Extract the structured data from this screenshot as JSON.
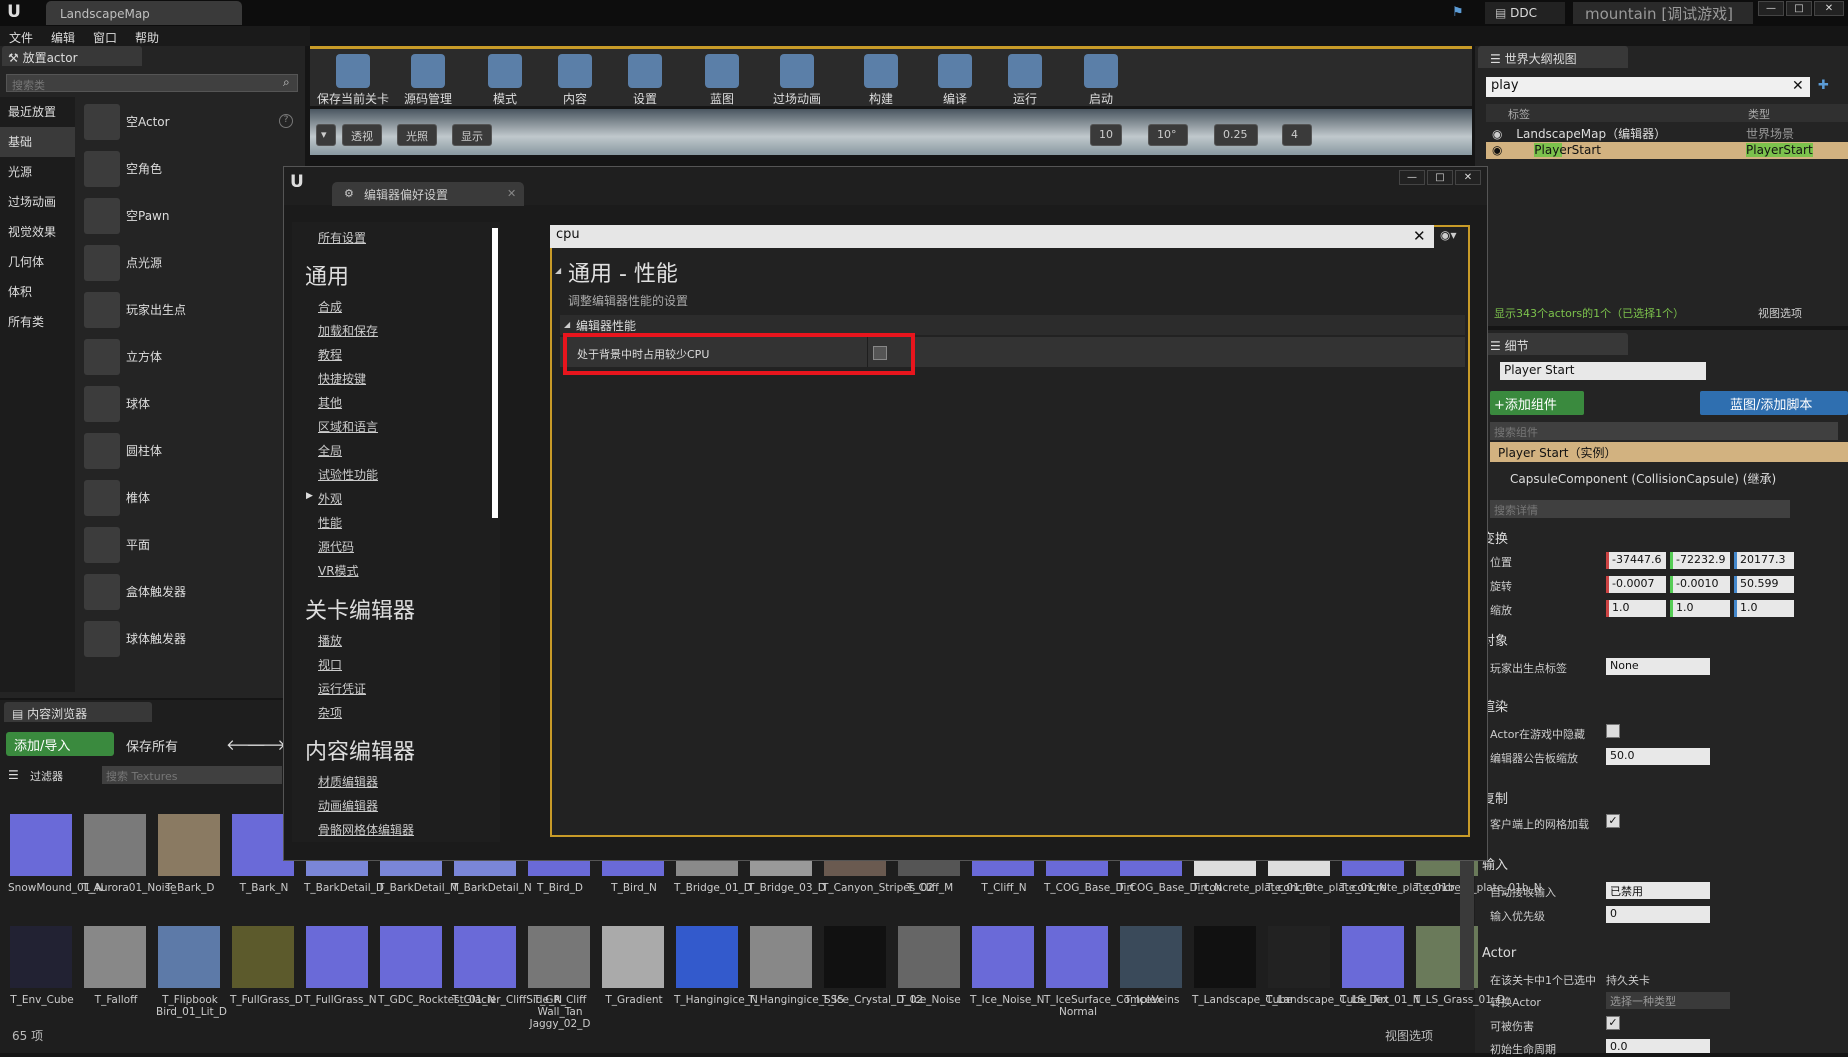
{
  "window": {
    "doc_tab": "LandscapeMap",
    "ddc": "DDC",
    "project": "mountain [调试游戏]"
  },
  "menu": [
    "文件",
    "编辑",
    "窗口",
    "帮助"
  ],
  "place_actors": {
    "tab": "放置actor",
    "search_placeholder": "搜索类",
    "categories": [
      "最近放置",
      "基础",
      "光源",
      "过场动画",
      "视觉效果",
      "几何体",
      "体积",
      "所有类"
    ],
    "items": [
      "空Actor",
      "空角色",
      "空Pawn",
      "点光源",
      "玩家出生点",
      "立方体",
      "球体",
      "圆柱体",
      "椎体",
      "平面",
      "盒体触发器",
      "球体触发器"
    ]
  },
  "toolbar": {
    "buttons": [
      "保存当前关卡",
      "源码管理",
      "模式",
      "内容",
      "设置",
      "蓝图",
      "过场动画",
      "构建",
      "编译",
      "运行",
      "启动"
    ]
  },
  "viewport": {
    "perspective": "透视",
    "lit": "光照",
    "show": "显示",
    "grid_snap": "10",
    "rot_snap": "10°",
    "scale_snap": "0.25",
    "cam_speed": "4"
  },
  "dialog": {
    "tab": "编辑器偏好设置",
    "search_value": "cpu",
    "section_title": "通用 - 性能",
    "section_desc": "调整编辑器性能的设置",
    "category": "编辑器性能",
    "property": "处于背景中时占用较少CPU",
    "property_checked": false,
    "nav": {
      "all": "所有设置",
      "general_head": "通用",
      "general": [
        "合成",
        "加载和保存",
        "教程",
        "快捷按键",
        "其他",
        "区域和语言",
        "全局",
        "试验性功能",
        "外观",
        "性能",
        "源代码",
        "VR模式"
      ],
      "level_head": "关卡编辑器",
      "level": [
        "播放",
        "视口",
        "运行凭证",
        "杂项"
      ],
      "content_head": "内容编辑器",
      "content": [
        "材质编辑器",
        "动画编辑器",
        "骨骼网格体编辑器"
      ]
    }
  },
  "outliner": {
    "tab": "世界大纲视图",
    "search_value": "play",
    "col_label": "标签",
    "col_type": "类型",
    "rows": [
      {
        "label": "LandscapeMap（编辑器）",
        "type": "世界场景"
      },
      {
        "label": "PlayerStart",
        "type": "PlayerStart"
      }
    ],
    "status": "显示343个actors的1个（已选择1个）",
    "view_options": "视图选项"
  },
  "details": {
    "tab": "细节",
    "name_value": "Player Start",
    "add_component": "+添加组件",
    "blueprint": "蓝图/添加脚本",
    "search_comp_placeholder": "搜索组件",
    "instance": "Player Start（实例）",
    "component": "CapsuleComponent (CollisionCapsule) (继承)",
    "search_details_placeholder": "搜索详情",
    "transform": "变换",
    "location_label": "位置",
    "location": [
      "-37447.6",
      "-72232.9",
      "20177.3"
    ],
    "rotation_label": "旋转",
    "rotation": [
      "-0.0007",
      "-0.0010",
      "50.599"
    ],
    "scale_label": "缩放",
    "scale": [
      "1.0",
      "1.0",
      "1.0"
    ],
    "object": "对象",
    "player_start_tag": "玩家出生点标签",
    "player_start_tag_value": "None",
    "rendering": "渲染",
    "hidden_in_game": "Actor在游戏中隐藏",
    "billboard_scale": "编辑器公告板缩放",
    "billboard_value": "50.0",
    "replication": "复制",
    "net_load": "客户端上的网格加载",
    "input": "输入",
    "auto_receive": "自动接收输入",
    "auto_receive_value": "已禁用",
    "input_priority": "输入优先级",
    "input_priority_value": "0",
    "actor": "Actor",
    "in_level": "在该关卡中1个已选中",
    "in_level_value": "持久关卡",
    "convert_actor": "转换Actor",
    "convert_value": "选择一种类型",
    "can_be_damaged": "可被伤害",
    "initial_lifespan": "初始生命周期",
    "initial_lifespan_value": "0.0"
  },
  "content_browser": {
    "tab": "内容浏览器",
    "add_import": "添加/导入",
    "save_all": "保存所有",
    "filters": "过滤器",
    "search_placeholder": "搜索 Textures",
    "count": "65 项",
    "view_options": "视图选项",
    "row1": [
      "SnowMound_01_N",
      "T_Aurora01_Noise",
      "T_Bark_D",
      "T_Bark_N",
      "T_BarkDetail_D",
      "T_BarkDetail_M",
      "T_BarkDetail_N",
      "T_Bird_D",
      "T_Bird_N",
      "T_Bridge_01_D",
      "T_Bridge_03_D",
      "T_Canyon_Stripes_02",
      "T_Cliff_M",
      "T_Cliff_N",
      "T_COG_Base_Dirt",
      "T_COG_Base_Dirt_N",
      "T_concrete_plate_01_D",
      "T_concrete_plate_01_N",
      "T_concrete_plate_01b_D",
      "T_concrete_plate_01b_N"
    ],
    "row2": [
      "T_Env_Cube",
      "T_Falloff",
      "T_Flipbook Bird_01_Lit_D",
      "T_FullGrass_D",
      "T_FullGrass_N",
      "T_GDC_Rocktest_01_N",
      "T_Glacier_CliffSide_N",
      "T_GR_Cliff Wall_Tan Jaggy_02_D",
      "T_Gradient",
      "T_Hangingice_N",
      "T_Hangingice_SSS",
      "T_Ice_Crystal_D_02",
      "T_Ice_Noise",
      "T_Ice_Noise_N",
      "T_IceSurface_Complex Normal",
      "T_IceVeins",
      "T_Landscape_Cube",
      "T_Landscape_Cube_Tex",
      "T_LS_Dirt_01_N",
      "T_LS_Grass_01_D"
    ]
  }
}
